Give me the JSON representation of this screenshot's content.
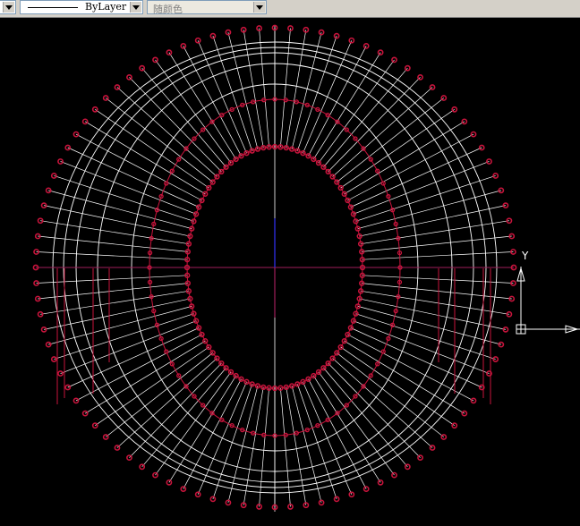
{
  "toolbar": {
    "linetype": {
      "value": "ByLayer"
    },
    "color": {
      "value": "随颜色"
    }
  },
  "ucs": {
    "y_label": "Y"
  },
  "colors": {
    "background": "#000000",
    "lines": "#ffffff",
    "markers": "#c8143c",
    "axis_x": "#a01e5a",
    "axis_y": "#2828c8"
  }
}
